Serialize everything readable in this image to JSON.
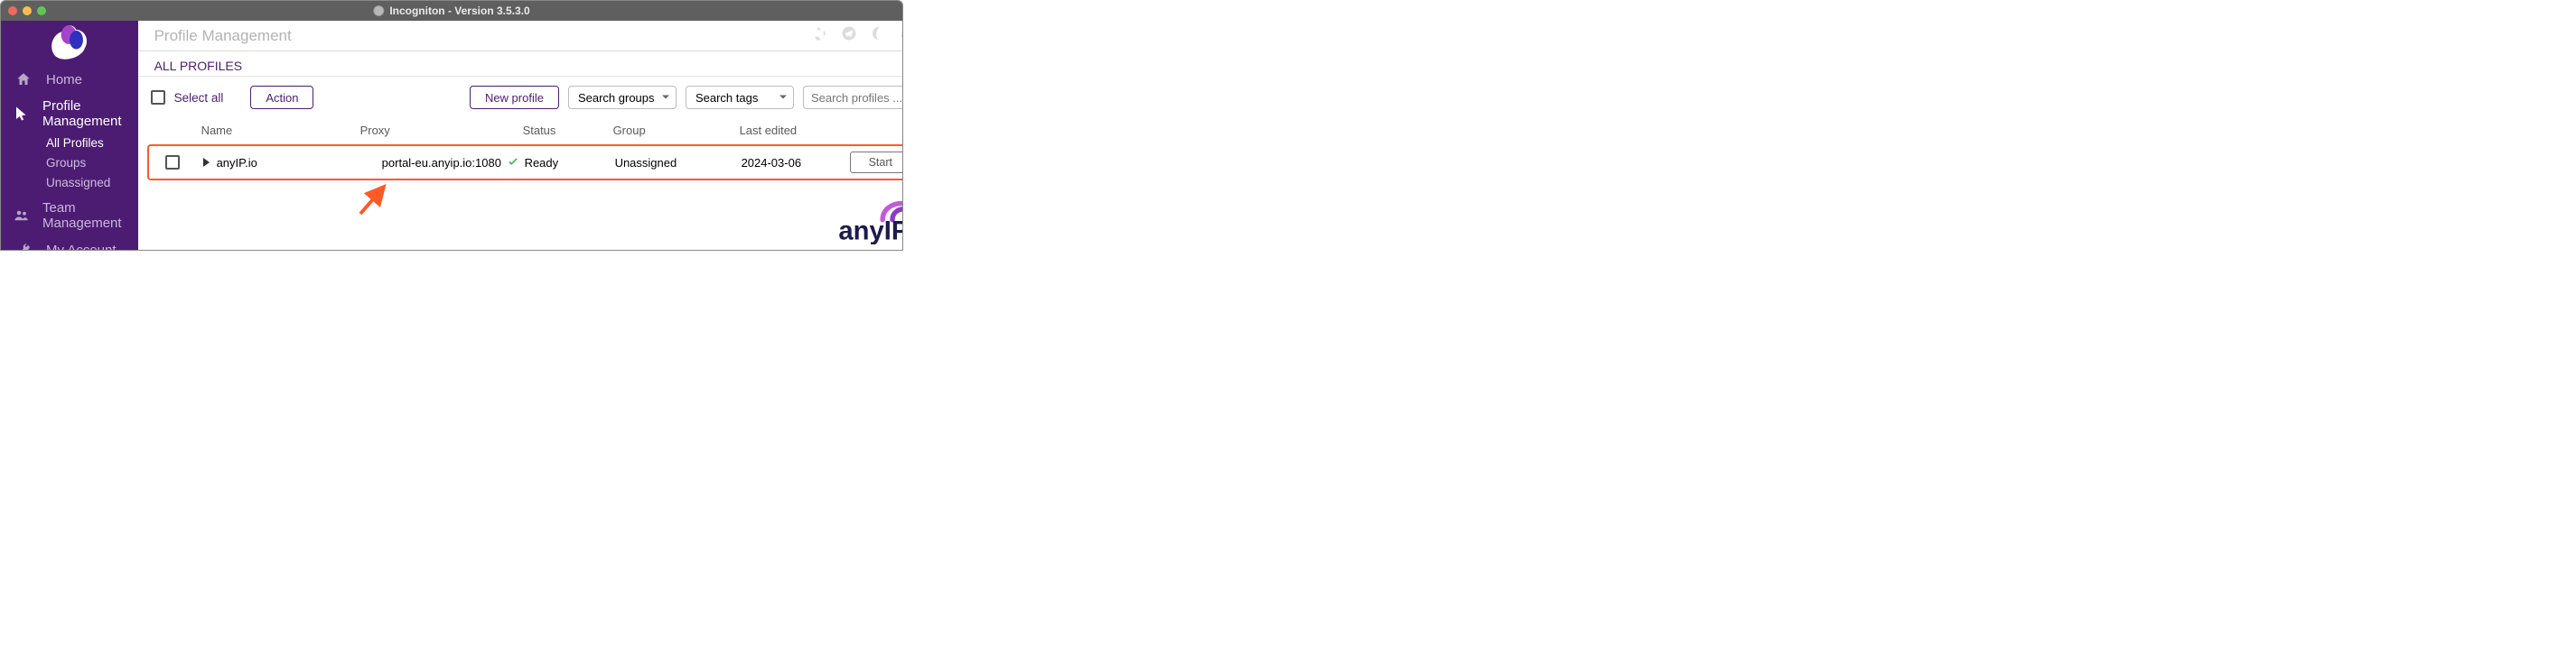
{
  "app": {
    "title": "Incogniton - Version 3.5.3.0"
  },
  "sidebar": {
    "items": [
      {
        "label": "Home",
        "icon": "home-icon",
        "active": false
      },
      {
        "label": "Profile Management",
        "icon": "cursor-icon",
        "active": true,
        "sub": [
          {
            "label": "All Profiles",
            "selected": true
          },
          {
            "label": "Groups",
            "selected": false
          },
          {
            "label": "Unassigned",
            "selected": false
          }
        ]
      },
      {
        "label": "Team Management",
        "icon": "team-icon",
        "active": false
      },
      {
        "label": "My Account",
        "icon": "wrench-icon",
        "active": false
      }
    ]
  },
  "page": {
    "title": "Profile Management",
    "section_title": "ALL PROFILES"
  },
  "toolbar": {
    "select_all": "Select all",
    "action": "Action",
    "new_profile": "New profile",
    "search_groups": "Search groups",
    "search_tags": "Search tags",
    "search_profiles_placeholder": "Search profiles ...."
  },
  "table": {
    "columns": {
      "name": "Name",
      "proxy": "Proxy",
      "status": "Status",
      "group": "Group",
      "last_edited": "Last edited"
    },
    "rows": [
      {
        "name": "anyIP.io",
        "proxy": "portal-eu.anyip.io:1080",
        "proxy_ok": true,
        "status": "Ready",
        "group": "Unassigned",
        "last_edited": "2024-03-06",
        "action": "Start"
      }
    ]
  },
  "watermark": {
    "brand": "anyIP"
  }
}
